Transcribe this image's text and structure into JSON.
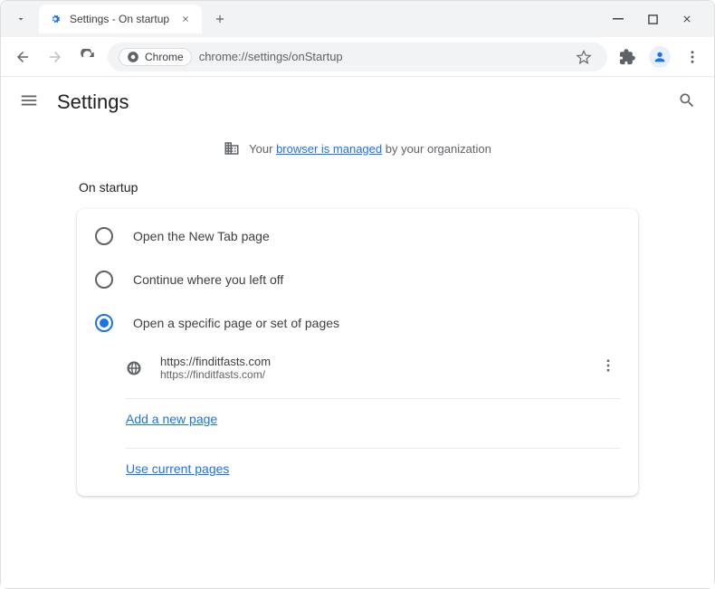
{
  "titlebar": {
    "tab_title": "Settings - On startup"
  },
  "toolbar": {
    "chip_label": "Chrome",
    "url": "chrome://settings/onStartup"
  },
  "header": {
    "title": "Settings"
  },
  "banner": {
    "prefix": "Your ",
    "link": "browser is managed",
    "suffix": " by your organization"
  },
  "section": {
    "title": "On startup",
    "options": {
      "new_tab": "Open the New Tab page",
      "continue": "Continue where you left off",
      "specific": "Open a specific page or set of pages"
    },
    "entry": {
      "url_display": "https://finditfasts.com",
      "url_full": "https://finditfasts.com/"
    },
    "actions": {
      "add": "Add a new page",
      "use_current": "Use current pages"
    }
  }
}
